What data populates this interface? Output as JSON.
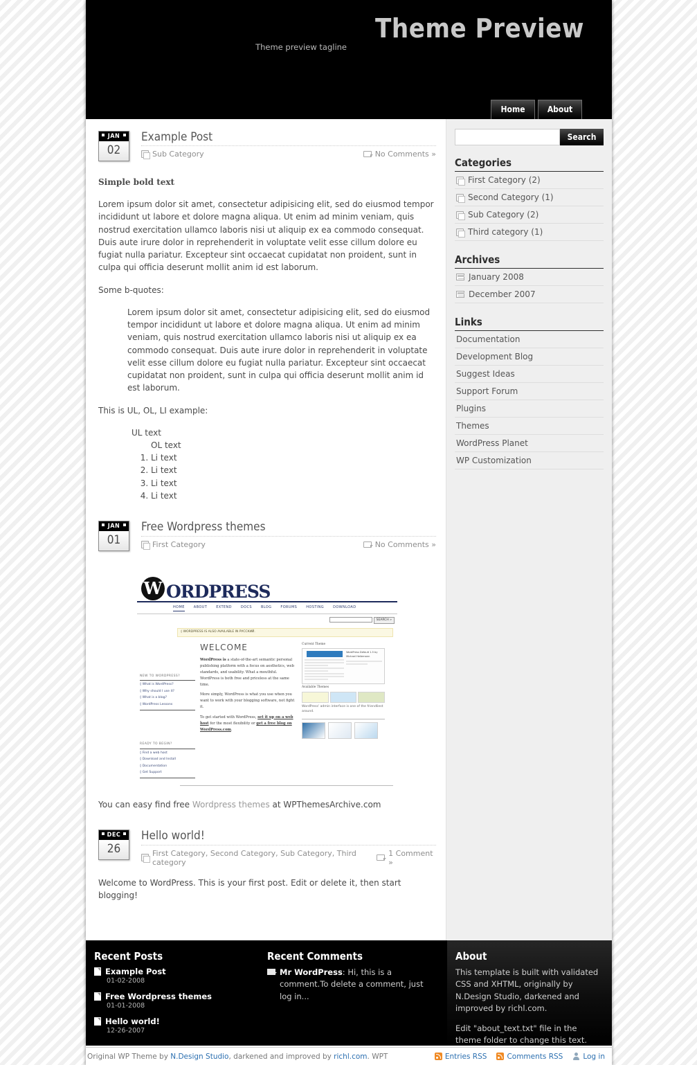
{
  "site": {
    "title": "Theme Preview",
    "tagline": "Theme preview tagline",
    "nav": [
      {
        "label": "Home"
      },
      {
        "label": "About"
      }
    ]
  },
  "posts": [
    {
      "month": "JAN",
      "day": "02",
      "title": "Example Post",
      "category": "Sub Category",
      "comments": "No Comments »",
      "bold_text": "Simple bold text",
      "paragraph1": "Lorem ipsum dolor sit amet, consectetur adipisicing elit, sed do eiusmod tempor incididunt ut labore et dolore magna aliqua. Ut enim ad minim veniam, quis nostrud exercitation ullamco laboris nisi ut aliquip ex ea commodo consequat. Duis aute irure dolor in reprehenderit in voluptate velit esse cillum dolore eu fugiat nulla pariatur. Excepteur sint occaecat cupidatat non proident, sunt in culpa qui officia deserunt mollit anim id est laborum.",
      "bquote_intro": "Some b-quotes:",
      "blockquote": "Lorem ipsum dolor sit amet, consectetur adipisicing elit, sed do eiusmod tempor incididunt ut labore et dolore magna aliqua. Ut enim ad minim veniam, quis nostrud exercitation ullamco laboris nisi ut aliquip ex ea commodo consequat. Duis aute irure dolor in reprehenderit in voluptate velit esse cillum dolore eu fugiat nulla pariatur. Excepteur sint occaecat cupidatat non proident, sunt in culpa qui officia deserunt mollit anim id est laborum.",
      "list_intro": "This is UL, OL, LI example:",
      "ul_text": "UL text",
      "ol_text": "OL text",
      "li_items": [
        "Li text",
        "Li text",
        "Li text",
        "Li text"
      ]
    },
    {
      "month": "JAN",
      "day": "01",
      "title": "Free Wordpress themes",
      "category": "First Category",
      "comments": "No Comments »",
      "caption_before": "You can easy find free ",
      "caption_link": "Wordpress themes",
      "caption_after": " at WPThemesArchive.com"
    },
    {
      "month": "DEC",
      "day": "26",
      "title": "Hello world!",
      "category": "First Category, Second Category, Sub Category, Third category",
      "comments": "1 Comment »",
      "body": "Welcome to WordPress. This is your first post. Edit or delete it, then start blogging!"
    }
  ],
  "wp_screenshot": {
    "logo_letter": "W",
    "logo_text": "ORDPRESS",
    "nav": [
      "HOME",
      "ABOUT",
      "EXTEND",
      "DOCS",
      "BLOG",
      "FORUMS",
      "HOSTING",
      "DOWNLOAD"
    ],
    "search_button": "SEARCH »",
    "notice": "◊ WORDPRESS IS ALSO AVAILABLE IN РУССКИЙ.",
    "col1_head1": "NEW TO WORDPRESS?",
    "col1_links1": [
      "◊ What is WordPress?",
      "◊ Why should I use it?",
      "◊ What is a blog?",
      "◊ WordPress Lessons"
    ],
    "col1_head2": "READY TO BEGIN?",
    "col1_links2": [
      "◊ Find a web host",
      "◊ Download and Install",
      "◊ Documentation",
      "◊ Get Support"
    ],
    "welcome": "WELCOME",
    "p1_bold": "WordPress is",
    "p1_rest": " a state-of-the-art semantic personal publishing platform with a focus on aesthetics, web standards, and usability. What a mouthful. WordPress is both free and priceless at the same time.",
    "p2": "More simply, WordPress is what you use when you want to work with your blogging software, not fight it.",
    "p3_a": "To get started with WordPress, ",
    "p3_link1": "set it up on a web host",
    "p3_b": " for the most flexibility or ",
    "p3_link2": "get a free blog on WordPress.com",
    "p3_c": ".",
    "panel_title": "Current Theme",
    "panel_sub": "WordPress Default 1.5 by Michael Heilemann",
    "available_themes": "Available Themes",
    "caption": "WordPress' admin interface is one of the friendliest around."
  },
  "sidebar": {
    "search": {
      "value": "",
      "placeholder": "",
      "button": "Search"
    },
    "widgets": [
      {
        "title": "Categories",
        "icon": "folder-icon",
        "items": [
          "First Category (2)",
          "Second Category (1)",
          "Sub Category (2)",
          "Third category (1)"
        ]
      },
      {
        "title": "Archives",
        "icon": "calendar-icon",
        "items": [
          "January 2008",
          "December 2007"
        ]
      },
      {
        "title": "Links",
        "icon": "none",
        "items": [
          "Documentation",
          "Development Blog",
          "Suggest Ideas",
          "Support Forum",
          "Plugins",
          "Themes",
          "WordPress Planet",
          "WP Customization"
        ]
      }
    ]
  },
  "footer": {
    "recent_posts": {
      "title": "Recent Posts",
      "items": [
        {
          "title": "Example Post",
          "date": "01-02-2008"
        },
        {
          "title": "Free Wordpress themes",
          "date": "01-01-2008"
        },
        {
          "title": "Hello world!",
          "date": "12-26-2007"
        }
      ]
    },
    "recent_comments": {
      "title": "Recent Comments",
      "author": "Mr WordPress",
      "text": ": Hi, this is a comment.To delete a comment, just log in..."
    },
    "about": {
      "title": "About",
      "p1": "This template is built with validated CSS and XHTML, originally by N.Design Studio, darkened and improved by richl.com.",
      "p2": "Edit \"about_text.txt\" file in the theme folder to change this text."
    }
  },
  "credit": {
    "pre": "Original WP Theme by ",
    "link1": "N.Design Studio",
    "mid": ", darkened and improved by ",
    "link2": "richl.com",
    "post": ". WPT",
    "rss": [
      {
        "label": "Entries RSS",
        "icon": "rss-icon"
      },
      {
        "label": "Comments RSS",
        "icon": "rss-icon"
      },
      {
        "label": "Log in",
        "icon": "user-icon"
      }
    ]
  }
}
